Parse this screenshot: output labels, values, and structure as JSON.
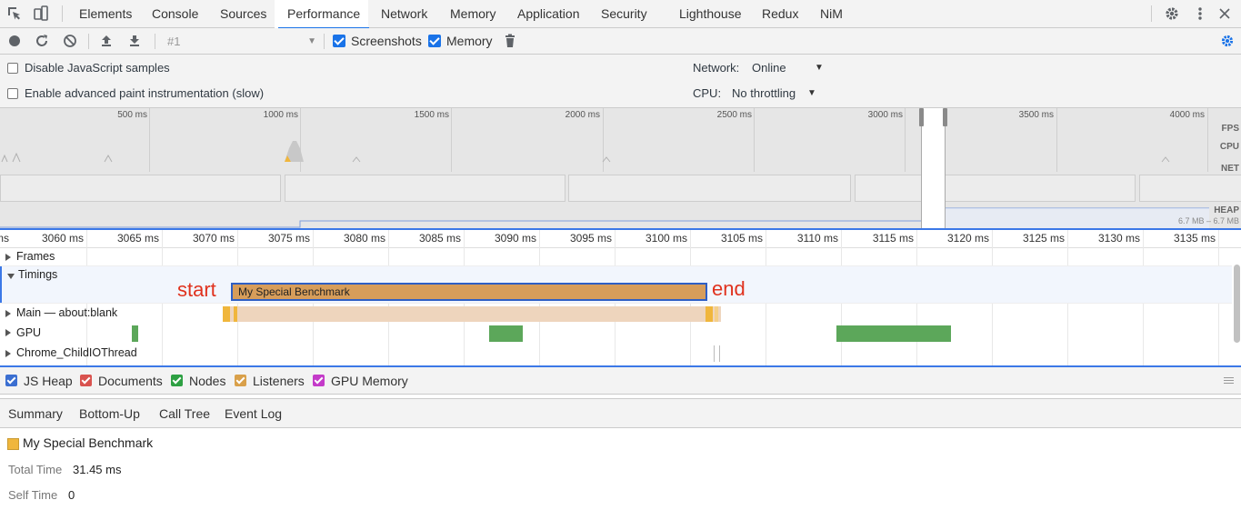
{
  "tabs": [
    {
      "label": "Elements"
    },
    {
      "label": "Console"
    },
    {
      "label": "Sources"
    },
    {
      "label": "Performance"
    },
    {
      "label": "Network"
    },
    {
      "label": "Memory"
    },
    {
      "label": "Application"
    },
    {
      "label": "Security"
    },
    {
      "label": "Lighthouse"
    },
    {
      "label": "Redux"
    },
    {
      "label": "NiM"
    }
  ],
  "active_tab": "Performance",
  "toolbar": {
    "profile_placeholder": "#1",
    "screenshots_label": "Screenshots",
    "screenshots_checked": true,
    "memory_label": "Memory",
    "memory_checked": true
  },
  "settings": {
    "disable_js_samples": "Disable JavaScript samples",
    "advanced_paint": "Enable advanced paint instrumentation (slow)",
    "network_label": "Network:",
    "network_value": "Online",
    "cpu_label": "CPU:",
    "cpu_value": "No throttling"
  },
  "overview": {
    "ticks": [
      "500 ms",
      "1000 ms",
      "1500 ms",
      "2000 ms",
      "2500 ms",
      "3000 ms",
      "3500 ms",
      "4000 ms"
    ],
    "side_labels": {
      "fps": "FPS",
      "cpu": "CPU",
      "net": "NET",
      "heap": "HEAP"
    },
    "heap_range": "6.7 MB – 6.7 MB"
  },
  "ruler": {
    "ticks": [
      "ms",
      "3060 ms",
      "3065 ms",
      "3070 ms",
      "3075 ms",
      "3080 ms",
      "3085 ms",
      "3090 ms",
      "3095 ms",
      "3100 ms",
      "3105 ms",
      "3110 ms",
      "3115 ms",
      "3120 ms",
      "3125 ms",
      "3130 ms",
      "3135 ms"
    ]
  },
  "tracks": {
    "frames": "Frames",
    "timings": "Timings",
    "main": "Main — about:blank",
    "gpu": "GPU",
    "io": "Chrome_ChildIOThread"
  },
  "timing_mark": {
    "label": "My Special Benchmark",
    "start_annotation": "start",
    "end_annotation": "end"
  },
  "memory_legend": [
    {
      "label": "JS Heap",
      "color": "#3b6fd1"
    },
    {
      "label": "Documents",
      "color": "#d9534f"
    },
    {
      "label": "Nodes",
      "color": "#2ea043"
    },
    {
      "label": "Listeners",
      "color": "#d9a04a"
    },
    {
      "label": "GPU Memory",
      "color": "#c43bc9"
    }
  ],
  "bottom_tabs": [
    {
      "label": "Summary"
    },
    {
      "label": "Bottom-Up"
    },
    {
      "label": "Call Tree"
    },
    {
      "label": "Event Log"
    }
  ],
  "summary": {
    "title": "My Special Benchmark",
    "total_time_label": "Total Time",
    "total_time_value": "31.45 ms",
    "self_time_label": "Self Time",
    "self_time_value": "0"
  },
  "colors": {
    "accent": "#1a73e8",
    "timing_bar": "#d79d5a",
    "gpu": "#5ca75a",
    "annotation_red": "#e0321e"
  }
}
